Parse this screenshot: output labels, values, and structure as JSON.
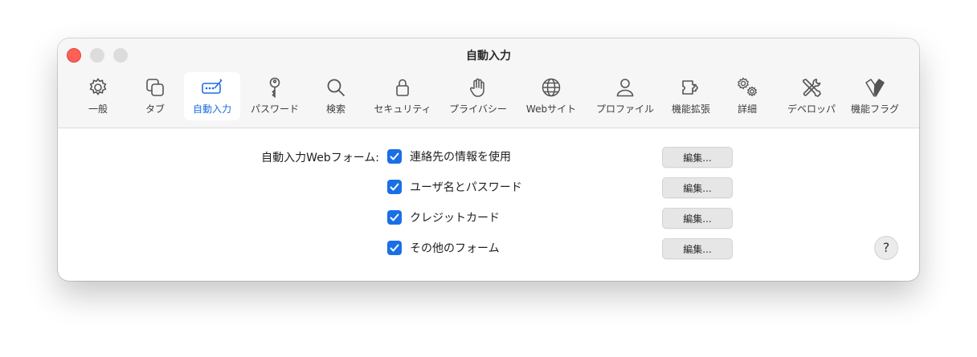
{
  "window": {
    "title": "自動入力"
  },
  "tabs": [
    {
      "label": "一般",
      "icon": "gear-icon",
      "active": false
    },
    {
      "label": "タブ",
      "icon": "tabs-icon",
      "active": false
    },
    {
      "label": "自動入力",
      "icon": "autofill-icon",
      "active": true
    },
    {
      "label": "パスワード",
      "icon": "key-icon",
      "active": false
    },
    {
      "label": "検索",
      "icon": "magnifier-icon",
      "active": false
    },
    {
      "label": "セキュリティ",
      "icon": "lock-icon",
      "active": false
    },
    {
      "label": "プライバシー",
      "icon": "hand-icon",
      "active": false
    },
    {
      "label": "Webサイト",
      "icon": "globe-icon",
      "active": false
    },
    {
      "label": "プロファイル",
      "icon": "person-icon",
      "active": false
    },
    {
      "label": "機能拡張",
      "icon": "puzzle-icon",
      "active": false
    },
    {
      "label": "詳細",
      "icon": "gears-icon",
      "active": false
    },
    {
      "label": "デベロッパ",
      "icon": "tools-icon",
      "active": false
    },
    {
      "label": "機能フラグ",
      "icon": "flags-icon",
      "active": false
    }
  ],
  "autofill": {
    "section_label": "自動入力Webフォーム:",
    "options": [
      {
        "label": "連絡先の情報を使用",
        "checked": true,
        "edit_label": "編集..."
      },
      {
        "label": "ユーザ名とパスワード",
        "checked": true,
        "edit_label": "編集..."
      },
      {
        "label": "クレジットカード",
        "checked": true,
        "edit_label": "編集..."
      },
      {
        "label": "その他のフォーム",
        "checked": true,
        "edit_label": "編集..."
      }
    ]
  },
  "help": {
    "label": "?"
  },
  "colors": {
    "accent": "#1a6fe6",
    "close": "#fe5f57"
  }
}
